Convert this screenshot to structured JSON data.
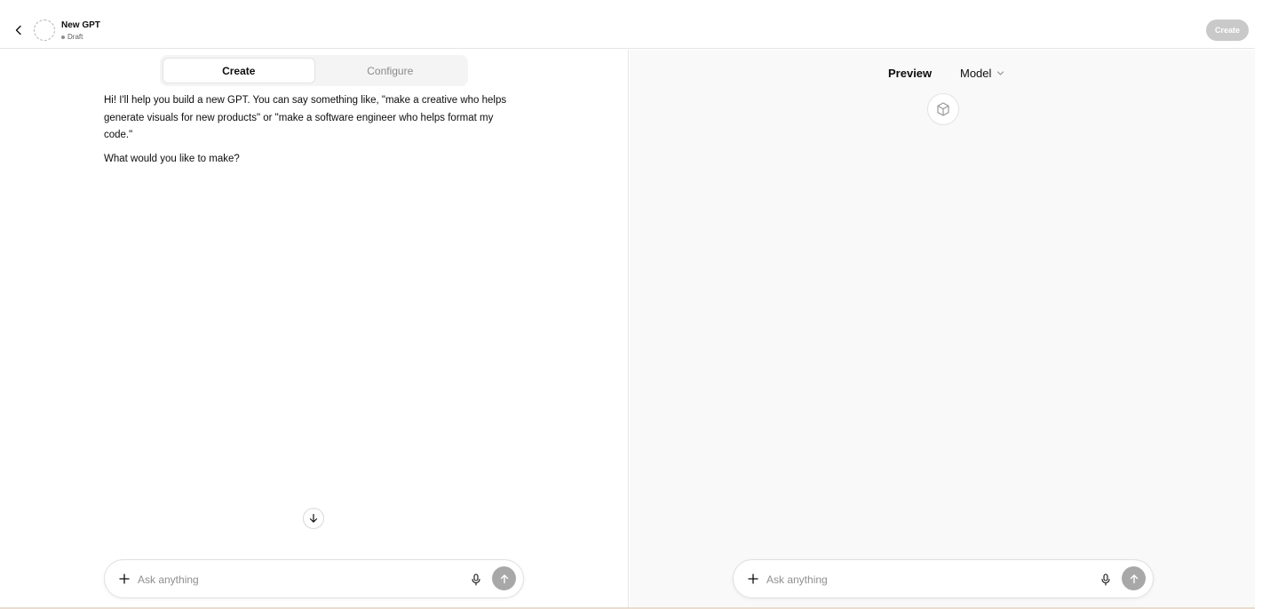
{
  "header": {
    "title": "New GPT",
    "status": "Draft",
    "create_button": "Create"
  },
  "editor": {
    "tabs": [
      {
        "label": "Create",
        "active": true
      },
      {
        "label": "Configure",
        "active": false
      }
    ],
    "intro_message": "Hi! I'll help you build a new GPT. You can say something like, \"make a creative who helps generate visuals for new products\" or \"make a software engineer who helps format my code.\"",
    "question": "What would you like to make?",
    "composer": {
      "placeholder": "Ask anything"
    }
  },
  "preview": {
    "label": "Preview",
    "model_label": "Model",
    "composer": {
      "placeholder": "Ask anything"
    }
  },
  "icons": {
    "back": "chevron-left-icon",
    "scroll_down": "arrow-down-icon",
    "plus": "plus-icon",
    "mic": "microphone-icon",
    "send": "arrow-up-icon",
    "model_caret": "chevron-down-icon",
    "gpt_placeholder": "cube-icon"
  },
  "colors": {
    "send_button": "#a8a8a8",
    "create_button": "#c9c9c9",
    "preview_bg": "#f9f9f9"
  }
}
